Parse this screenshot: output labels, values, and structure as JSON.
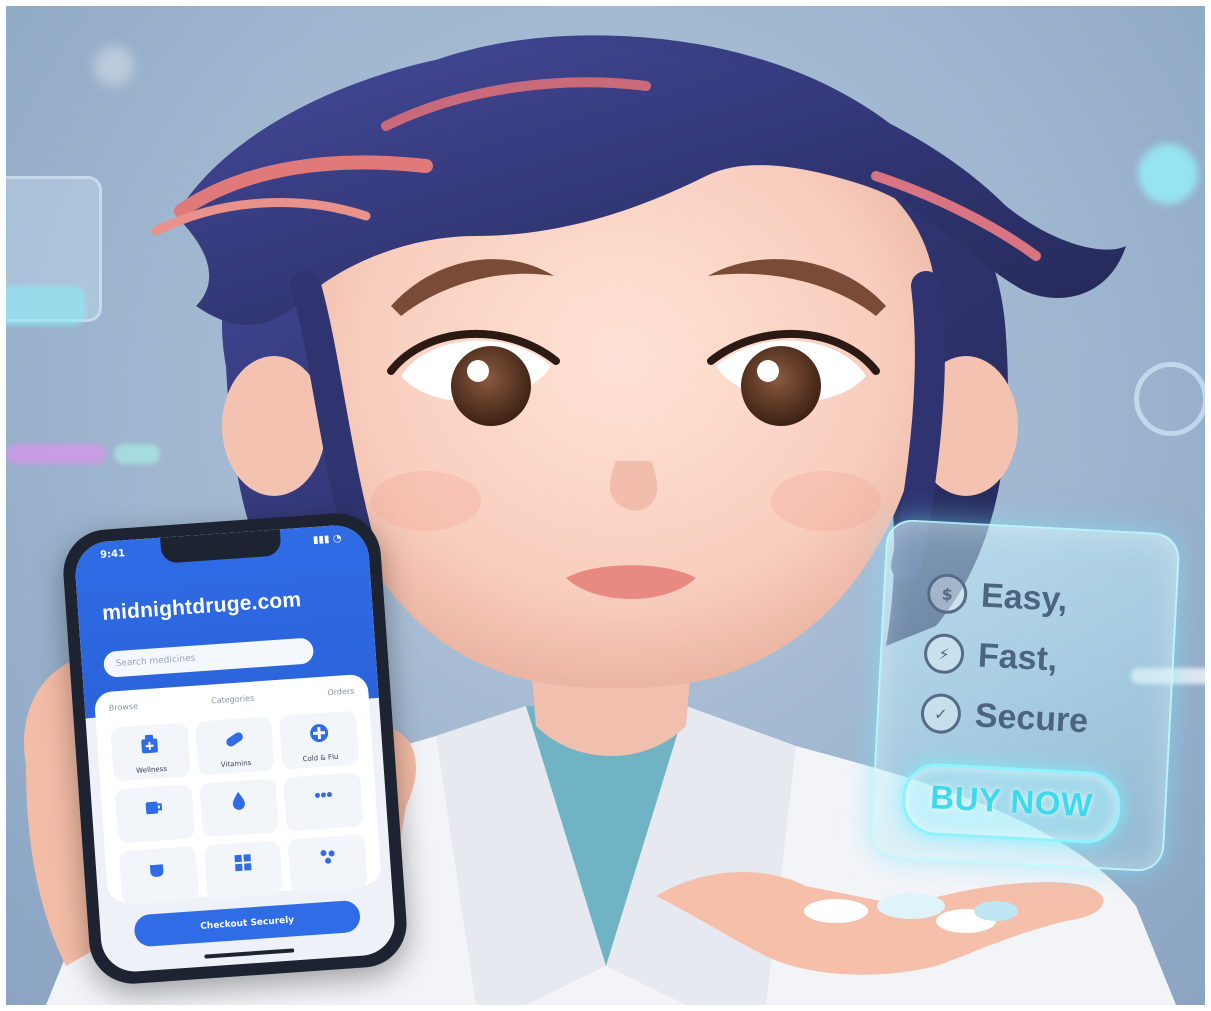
{
  "phone": {
    "status_time": "9:41",
    "status_icons": "▮▮▮ ◔",
    "site_title": "midnightdruge.com",
    "search_placeholder": "Search medicines",
    "tabs": [
      "Browse",
      "Categories",
      "Orders"
    ],
    "tiles": [
      {
        "icon": "pill-box-icon",
        "label": "Wellness"
      },
      {
        "icon": "capsule-icon",
        "label": "Vitamins"
      },
      {
        "icon": "first-aid-icon",
        "label": "Cold & Flu"
      },
      {
        "icon": "cup-icon",
        "label": ""
      },
      {
        "icon": "drop-icon",
        "label": ""
      },
      {
        "icon": "dots-icon",
        "label": ""
      },
      {
        "icon": "mug-icon",
        "label": ""
      },
      {
        "icon": "grid-icon",
        "label": ""
      },
      {
        "icon": "cluster-icon",
        "label": ""
      }
    ],
    "cta_label": "Checkout Securely"
  },
  "holo_panel": {
    "features": [
      {
        "icon": "money-bag-icon",
        "label": "Easy,"
      },
      {
        "icon": "bolt-icon",
        "label": "Fast,"
      },
      {
        "icon": "lock-icon",
        "label": "Secure"
      }
    ],
    "buy_label": "BUY NOW"
  },
  "colors": {
    "background": "#9fb6cf",
    "phone_accent": "#2f6ce5",
    "holo_glow": "#8ff2ff",
    "hair_primary": "#3b3f8a",
    "hair_highlight": "#e07a7a",
    "coat": "#f3f4f8",
    "scrubs": "#6fb3c4"
  }
}
